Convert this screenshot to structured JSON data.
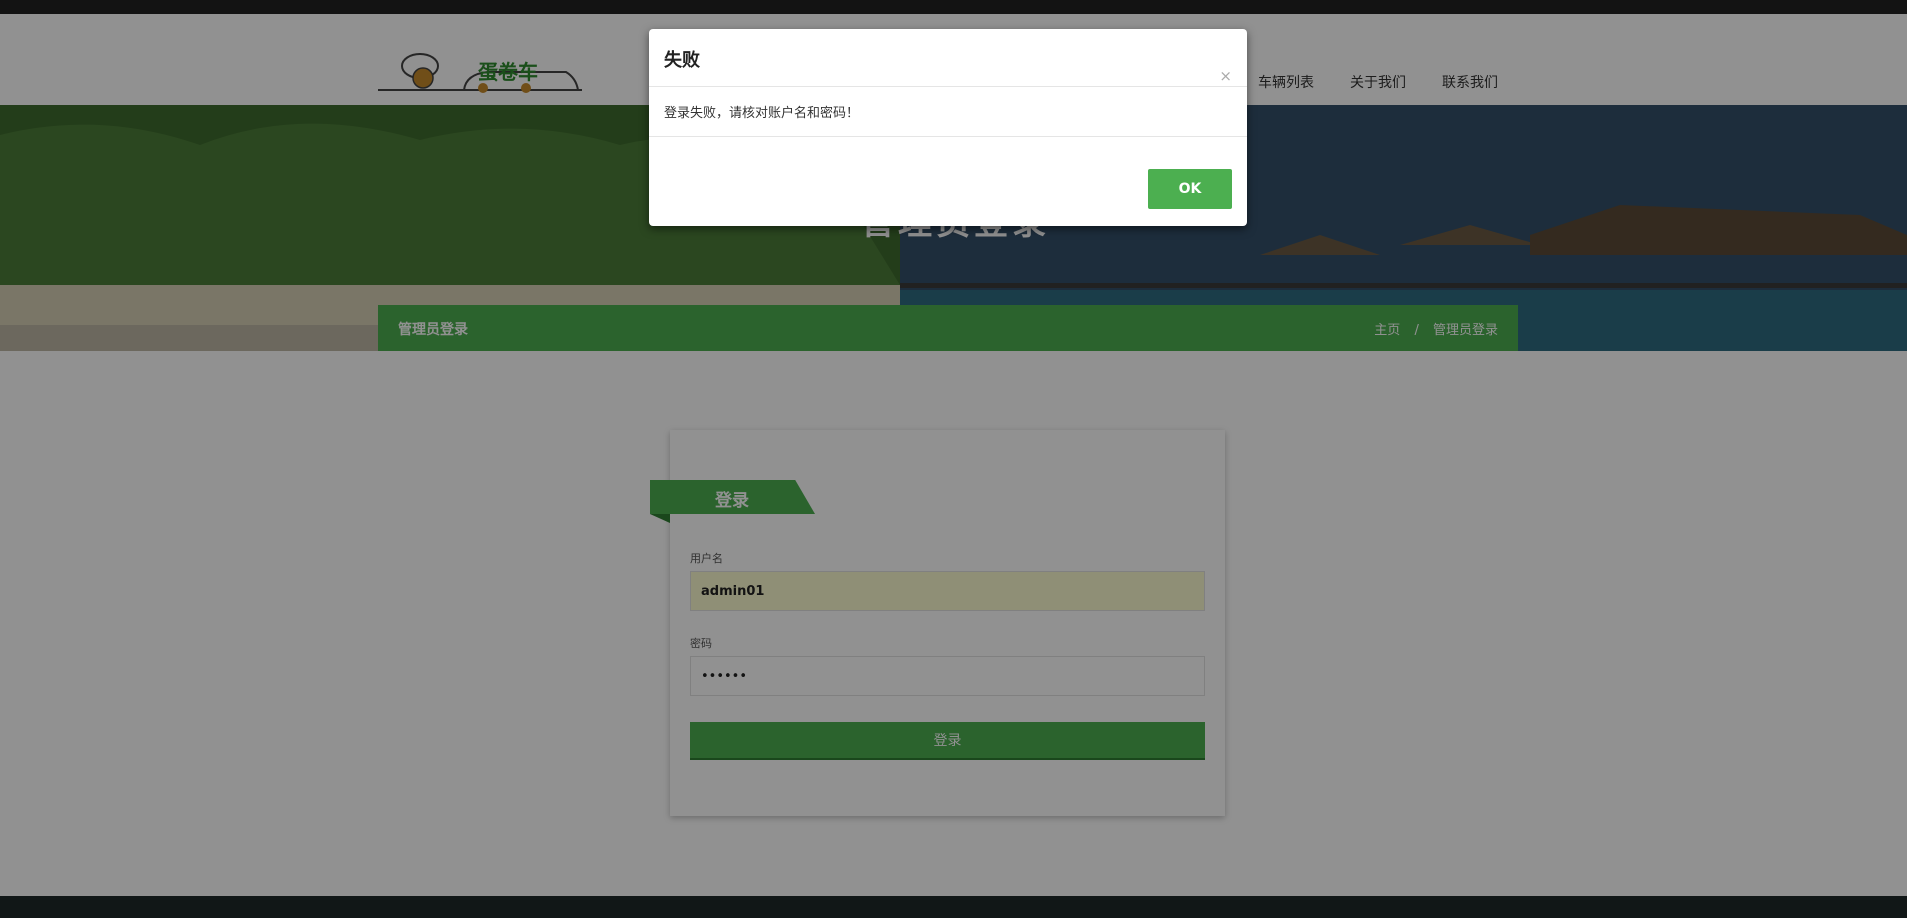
{
  "header": {
    "logo_text": "蛋卷车",
    "nav": [
      "车辆列表",
      "关于我们",
      "联系我们"
    ]
  },
  "hero": {
    "title": "管理员登录"
  },
  "breadcrumb": {
    "title": "管理员登录",
    "home": "主页",
    "separator": "/",
    "current": "管理员登录"
  },
  "login": {
    "heading": "登录",
    "username_label": "用户名",
    "username_value": "admin01",
    "password_label": "密码",
    "password_value": "••••••",
    "submit_label": "登录"
  },
  "modal": {
    "title": "失败",
    "close": "×",
    "message": "登录失败，请核对账户名和密码！",
    "ok": "OK"
  },
  "colors": {
    "accent": "#4caf50",
    "accent_dark": "#2e7d32",
    "overlay": "#000000"
  }
}
